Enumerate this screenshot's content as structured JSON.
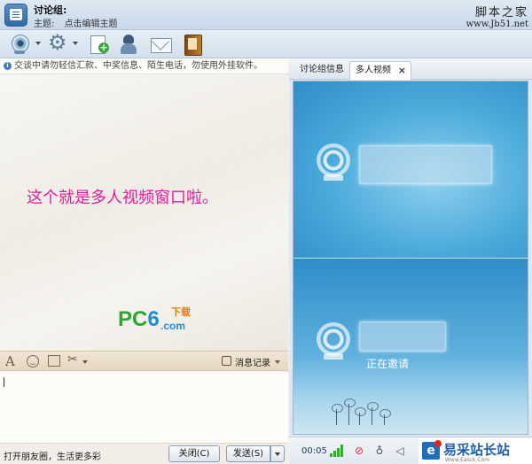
{
  "window": {
    "group_name": "讨论组:",
    "topic_label": "主题:",
    "topic_edit": "点击编辑主题"
  },
  "watermark": {
    "title": "脚本之家",
    "url": "www.Jb51.net"
  },
  "toolbar": {
    "icons": [
      "video-camera-icon",
      "settings-gear-icon",
      "add-file-icon",
      "contact-person-icon",
      "mail-icon",
      "notebook-icon"
    ]
  },
  "chat": {
    "notice": "交谈中请勿轻信汇款、中奖信息、陌生电话，勿使用外挂软件。",
    "caption": "这个就是多人视频窗口啦。",
    "caption_color": "#e2199a",
    "logo": {
      "pc": "PC",
      "six": "6",
      "download": "下载",
      "com": ".com"
    },
    "history_label": "消息记录",
    "promo": "打开朋友圈，生活更多彩",
    "close_button": "关闭(C)",
    "send_button": "发送(S)"
  },
  "video_panel": {
    "tabs": [
      {
        "label": "讨论组信息"
      },
      {
        "label": "多人视频"
      }
    ],
    "tab_close": "×",
    "inviting": "正在邀请",
    "elapsed_time": "00:05"
  },
  "site_badge": {
    "name": "易采站长站",
    "url": "Www.Easck.Com"
  }
}
